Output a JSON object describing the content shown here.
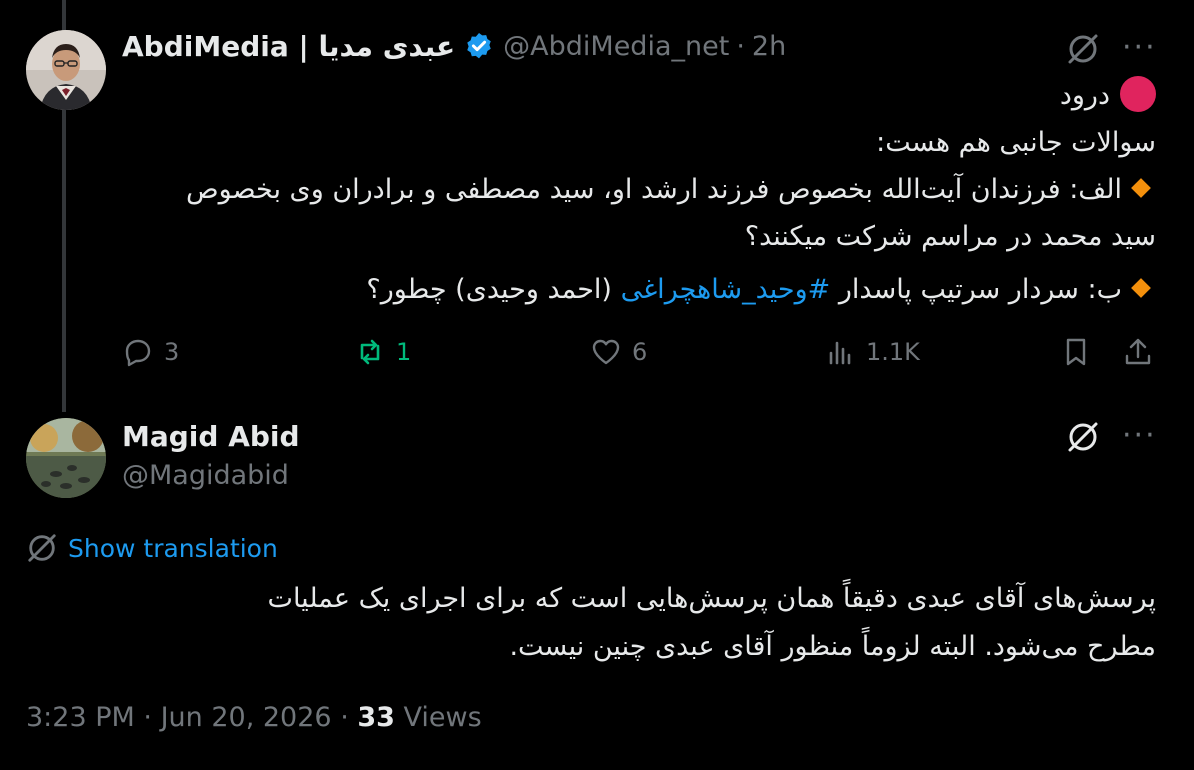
{
  "parent_tweet": {
    "display_name": "AbdiMedia | عبدی مدیا",
    "handle": "@AbdiMedia_net",
    "separator": "·",
    "time": "2h",
    "lines": {
      "greeting": "درود",
      "intro": "سوالات جانبی هم هست:",
      "item_a_line1": "الف: فرزندان آیت‌الله بخصوص فرزند ارشد او، سید مصطفی و برادران وی بخصوص",
      "item_a_line2": "سید محمد در مراسم شرکت میکنند؟",
      "item_b_prefix": "ب: سردار سرتیپ پاسدار",
      "item_b_hashtag": "#وحید_شاهچراغی",
      "item_b_suffix": "(احمد وحیدی) چطور؟"
    },
    "actions": {
      "replies": "3",
      "reposts": "1",
      "likes": "6",
      "views": "1.1K"
    }
  },
  "reply_tweet": {
    "display_name": "Magid Abid",
    "handle": "@Magidabid",
    "show_translation": "Show translation",
    "line1": "پرسش‌های آقای عبدی دقیقاً همان پرسش‌هایی است که برای اجرای یک عملیات",
    "line2": "مطرح می‌شود. البته لزوماً منظور آقای عبدی چنین نیست.",
    "time": "3:23 PM",
    "date": "Jun 20, 2026",
    "dot": "·",
    "views_count": "33",
    "views_label": "Views"
  },
  "icons": {
    "more": "more-horizontal-icon",
    "grok": "grok-icon",
    "verified": "verified-badge-icon"
  },
  "colors": {
    "background": "#000000",
    "text": "#e7e9ea",
    "muted": "#71767b",
    "link": "#1d9bf0",
    "repost": "#00ba7c",
    "verified": "#1d9bf0"
  }
}
